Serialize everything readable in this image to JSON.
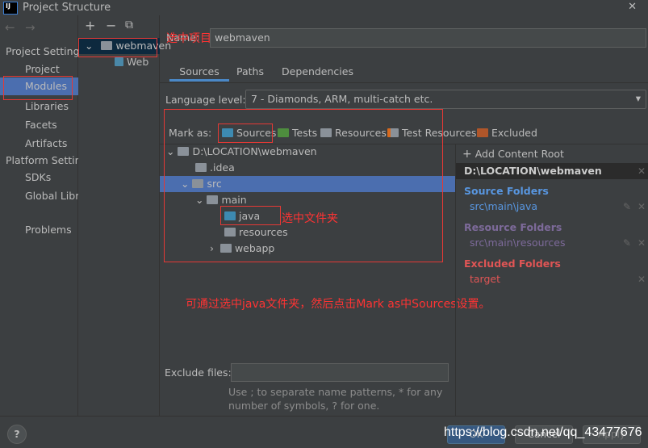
{
  "window": {
    "title": "Project Structure",
    "close": "✕",
    "logo": "IJ"
  },
  "nav": {
    "back": "←",
    "forward": "→",
    "section1": "Project Settings",
    "items1": [
      "Project",
      "Modules",
      "Libraries",
      "Facets",
      "Artifacts"
    ],
    "section2": "Platform Settings",
    "items2": [
      "SDKs",
      "Global Libraries"
    ],
    "problems": "Problems"
  },
  "modules": {
    "add": "+",
    "remove": "−",
    "copy": "⧉",
    "root": "webmaven",
    "child": "Web"
  },
  "main": {
    "name_label": "Name:",
    "name_value": "webmaven",
    "tabs": [
      "Sources",
      "Paths",
      "Dependencies"
    ],
    "language_label": "Language level:",
    "language_value": "7 - Diamonds, ARM, multi-catch etc.",
    "mark_as": "Mark as:",
    "marks": [
      "Sources",
      "Tests",
      "Resources",
      "Test Resources",
      "Excluded"
    ],
    "tree": [
      "D:\\LOCATION\\webmaven",
      ".idea",
      "src",
      "main",
      "java",
      "resources",
      "webapp"
    ],
    "exclude_label": "Exclude files:",
    "exclude_value": "",
    "hint": "Use ; to separate name patterns, * for any number of symbols, ? for one."
  },
  "roots": {
    "add": "Add Content Root",
    "path": "D:\\LOCATION\\webmaven",
    "source_title": "Source Folders",
    "source_item": "src\\main\\java",
    "resource_title": "Resource Folders",
    "resource_item": "src\\main\\resources",
    "excluded_title": "Excluded Folders",
    "excluded_item": "target"
  },
  "annotations": {
    "select_project": "选中项目",
    "select_folder": "选中文件夹",
    "instruction": "可通过选中java文件夹，然后点击Mark as中Sources设置。",
    "watermark": "https://blog.csdn.net/qq_43477676"
  },
  "footer": {
    "help": "?",
    "ok": "OK",
    "cancel": "Cancel",
    "apply": "Apply"
  },
  "colors": {
    "source": "#5896e0",
    "resource": "#7d6a9a",
    "excluded": "#e05555",
    "selection": "#4b6eaf"
  }
}
